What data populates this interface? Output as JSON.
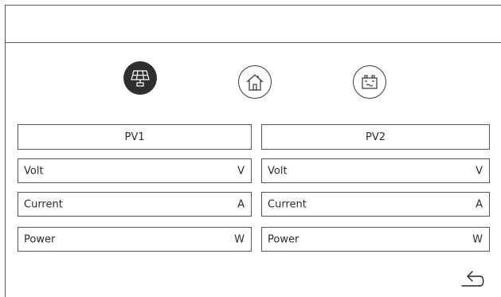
{
  "nav": {
    "tabs": [
      {
        "name": "solar-panel-icon",
        "state": "active"
      },
      {
        "name": "home-icon",
        "state": "inactive"
      },
      {
        "name": "battery-icon",
        "state": "inactive"
      }
    ]
  },
  "colors": {
    "active_tab": "#2f2f2f",
    "border": "#555555",
    "text": "#2b2b2b"
  },
  "pv1": {
    "title": "PV1",
    "rows": [
      {
        "label": "Volt",
        "unit": "V"
      },
      {
        "label": "Current",
        "unit": "A"
      },
      {
        "label": "Power",
        "unit": "W"
      }
    ]
  },
  "pv2": {
    "title": "PV2",
    "rows": [
      {
        "label": "Volt",
        "unit": "V"
      },
      {
        "label": "Current",
        "unit": "A"
      },
      {
        "label": "Power",
        "unit": "W"
      }
    ]
  },
  "back_icon": "return-arrow-icon"
}
